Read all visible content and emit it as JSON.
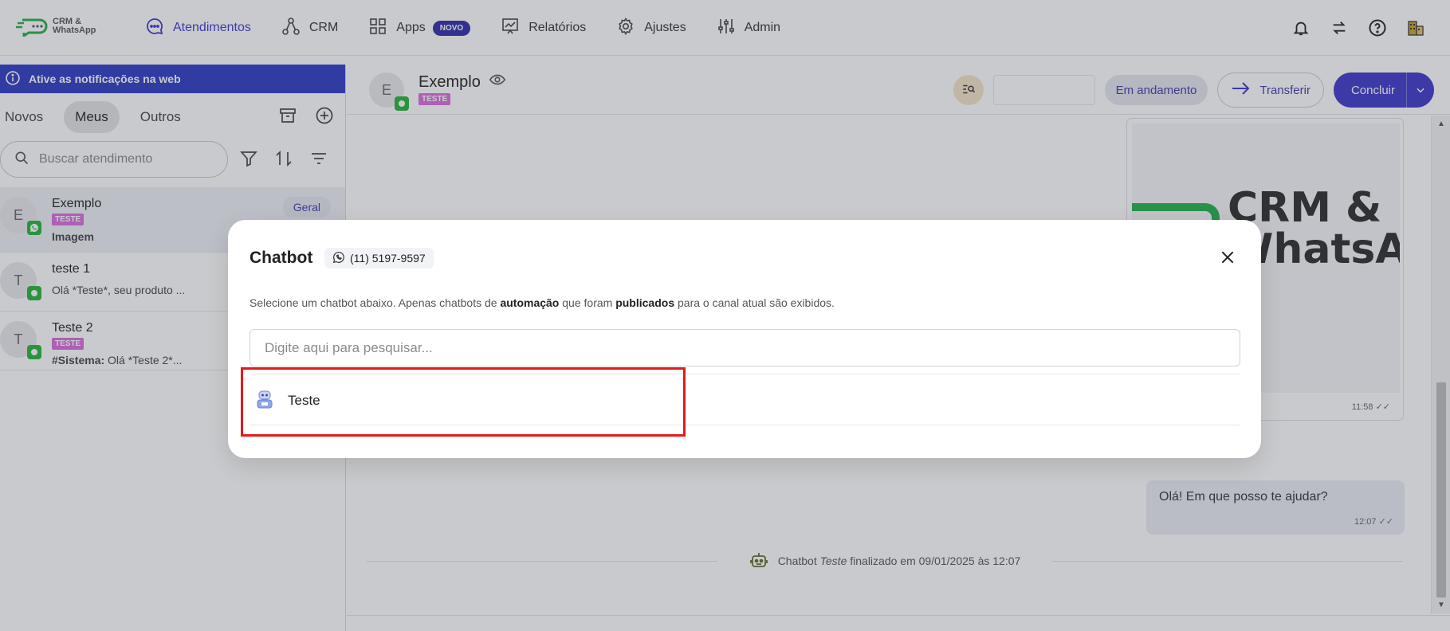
{
  "app": {
    "logo_line1": "CRM &",
    "logo_line2": "WhatsApp",
    "brand_color": "#3d36c9"
  },
  "nav": {
    "items": [
      {
        "label": "Atendimentos",
        "icon": "chat-bubble-icon",
        "active": true
      },
      {
        "label": "CRM",
        "icon": "crm-nodes-icon"
      },
      {
        "label": "Apps",
        "icon": "apps-grid-icon",
        "badge": "NOVO"
      },
      {
        "label": "Relatórios",
        "icon": "report-chart-icon"
      },
      {
        "label": "Ajustes",
        "icon": "gear-icon"
      },
      {
        "label": "Admin",
        "icon": "sliders-icon"
      }
    ],
    "right_icons": [
      "bell-icon",
      "transfer-arrows-icon",
      "help-icon",
      "buildings-icon"
    ]
  },
  "left_panel": {
    "notification_banner": "Ative as notificações na web",
    "tabs": [
      "Novos",
      "Meus",
      "Outros"
    ],
    "active_tab": "Meus",
    "search_placeholder": "Buscar atendimento",
    "conversations": [
      {
        "initial": "E",
        "name": "Exemplo",
        "tag": "TESTE",
        "preview_bold": "Imagem",
        "preview": "",
        "queue": "Geral"
      },
      {
        "initial": "T",
        "name": "teste 1",
        "tag": "",
        "preview_bold": "",
        "preview": "Olá *Teste*, seu produto ..."
      },
      {
        "initial": "T",
        "name": "Teste 2",
        "tag": "TESTE",
        "preview_bold": "#Sistema:",
        "preview": " Olá *Teste 2*..."
      }
    ]
  },
  "chat": {
    "contact_initial": "E",
    "contact_name": "Exemplo",
    "contact_tag": "TESTE",
    "status": "Em andamento",
    "transfer_label": "Transferir",
    "conclude_label": "Concluir",
    "image_text_line1": "CRM &",
    "image_text_line2": "WhatsAp",
    "image_time": "11:58",
    "message_text": "Olá! Em que posso te ajudar?",
    "message_time": "12:07",
    "system_prefix": "Chatbot ",
    "system_bot_name": "Teste",
    "system_suffix": " finalizado em 09/01/2025 às 12:07"
  },
  "modal": {
    "title": "Chatbot",
    "phone": "(11) 5197-9597",
    "desc_part1": "Selecione um chatbot abaixo. Apenas chatbots de ",
    "desc_bold1": "automação",
    "desc_part2": " que foram ",
    "desc_bold2": "publicados",
    "desc_part3": " para o canal atual são exibidos.",
    "search_placeholder": "Digite aqui para pesquisar...",
    "bots": [
      {
        "name": "Teste",
        "icon": "robot-icon"
      }
    ],
    "highlight_color": "#e01b1b"
  }
}
